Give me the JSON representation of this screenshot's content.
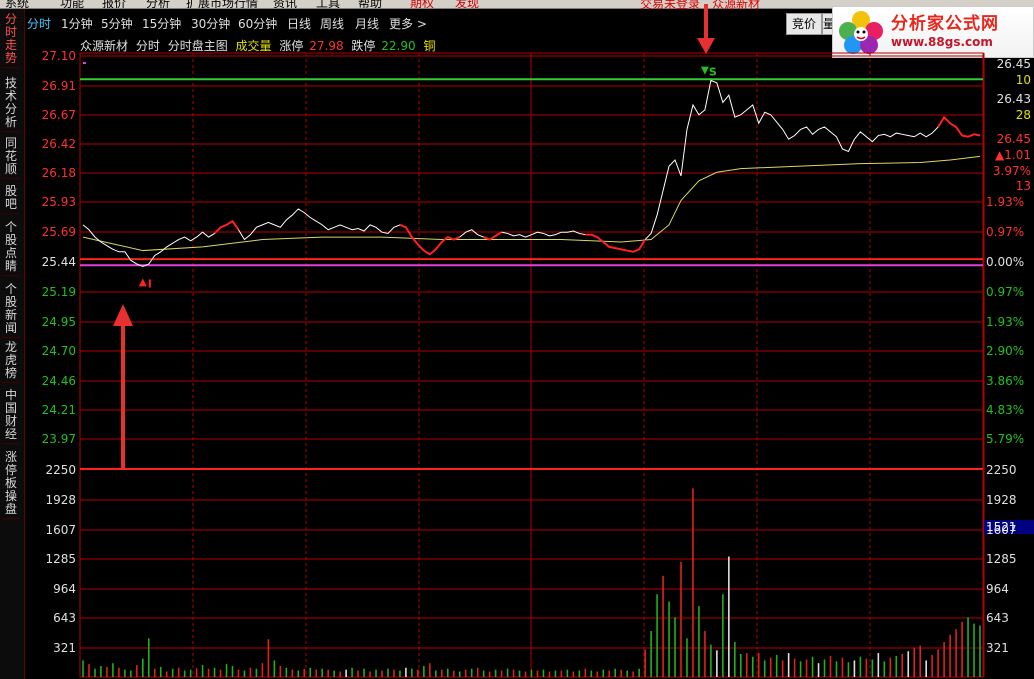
{
  "menu": {
    "items": [
      "系统",
      "功能",
      "报价",
      "分析",
      "扩展市场行情",
      "资讯",
      "工具",
      "帮助",
      "期权",
      "发现"
    ],
    "right_links": [
      "交易未登录",
      "众源新材"
    ]
  },
  "left_tabs": [
    {
      "label": "分时走势",
      "active": true
    },
    {
      "label": "技术分析",
      "active": false
    },
    {
      "label": "同花顺",
      "active": false
    },
    {
      "label": "股吧",
      "active": false
    },
    {
      "label": "个股点睛",
      "active": false
    },
    {
      "label": "个股新闻",
      "active": false
    },
    {
      "label": "龙虎榜",
      "active": false
    },
    {
      "label": "中国财经",
      "active": false
    },
    {
      "label": "涨停板操盘",
      "active": false
    }
  ],
  "period_tabs": [
    {
      "label": "分时",
      "active": true
    },
    {
      "label": "1分钟",
      "active": false
    },
    {
      "label": "5分钟",
      "active": false
    },
    {
      "label": "15分钟",
      "active": false
    },
    {
      "label": "30分钟",
      "active": false
    },
    {
      "label": "60分钟",
      "active": false
    },
    {
      "label": "日线",
      "active": false
    },
    {
      "label": "周线",
      "active": false
    },
    {
      "label": "月线",
      "active": false
    },
    {
      "label": "更多 >",
      "active": false
    }
  ],
  "auction_button": "竞价",
  "auction_button2": "量",
  "logo": {
    "title": "分析家公式网",
    "url_text": "www.88gs.com"
  },
  "info": {
    "stock_name": "众源新材",
    "chart_mode": "分时",
    "indicator": "分时盘主图",
    "volume_label": "成交量",
    "limit_up_label": "涨停",
    "limit_up_value": "27.98",
    "limit_down_label": "跌停",
    "limit_down_value": "22.90",
    "metal": "铜"
  },
  "colors": {
    "grid": "#b40000",
    "price_line_white": "#ffffff",
    "price_line_red": "#ff2020",
    "avg_line": "#d8d860",
    "up": "#ff3030",
    "down": "#20c020",
    "limit_green": "#33cc33",
    "limit_magenta": "#e040e0",
    "volume_up": "#e02020",
    "volume_down": "#20b020",
    "volume_white": "#e0e0e0"
  },
  "signals": {
    "buy_label": "I",
    "sell_label": "S"
  },
  "price_axis_left": [
    {
      "v": "27.10",
      "c": "up"
    },
    {
      "v": "26.91",
      "c": "up"
    },
    {
      "v": "26.67",
      "c": "up"
    },
    {
      "v": "26.42",
      "c": "up"
    },
    {
      "v": "26.18",
      "c": "up"
    },
    {
      "v": "25.93",
      "c": "up"
    },
    {
      "v": "25.69",
      "c": "up"
    },
    {
      "v": "25.44",
      "c": "flat"
    },
    {
      "v": "25.19",
      "c": "down"
    },
    {
      "v": "24.95",
      "c": "down"
    },
    {
      "v": "24.70",
      "c": "down"
    },
    {
      "v": "24.46",
      "c": "down"
    },
    {
      "v": "24.21",
      "c": "down"
    },
    {
      "v": "23.97",
      "c": "down"
    }
  ],
  "pct_axis_right": [
    {
      "v": "1.93%",
      "c": "up"
    },
    {
      "v": "0.97%",
      "c": "up"
    },
    {
      "v": "0.00%",
      "c": "flat"
    },
    {
      "v": "0.97%",
      "c": "down"
    },
    {
      "v": "1.93%",
      "c": "down"
    },
    {
      "v": "2.90%",
      "c": "down"
    },
    {
      "v": "3.86%",
      "c": "down"
    },
    {
      "v": "4.83%",
      "c": "down"
    },
    {
      "v": "5.79%",
      "c": "down"
    }
  ],
  "right_quote": [
    {
      "v": "26.45",
      "c": "flat"
    },
    {
      "v": "10",
      "c": "ylw"
    },
    {
      "v": "26.43",
      "c": "flat"
    },
    {
      "v": "28",
      "c": "ylw"
    },
    {
      "v": "26.45",
      "c": "up"
    },
    {
      "v": "▲1.01",
      "c": "up"
    },
    {
      "v": "3.97%",
      "c": "up"
    },
    {
      "v": "13",
      "c": "up"
    }
  ],
  "volume_axis": [
    "2250",
    "1928",
    "1607",
    "1285",
    "964",
    "643",
    "321"
  ],
  "volume_current": "1521",
  "chart_data": [
    {
      "type": "line",
      "title": "分时盘主图",
      "y_range": [
        23.97,
        27.1
      ],
      "prev_close": 25.44,
      "limit_up_line": 26.91,
      "limit_down_line": 25.39,
      "series": [
        {
          "points": [
            [
              0,
              25.72
            ],
            [
              1,
              25.68
            ],
            [
              2,
              25.62
            ],
            [
              3,
              25.58
            ],
            [
              4,
              25.55
            ],
            [
              5,
              25.52
            ],
            [
              6,
              25.5
            ],
            [
              7,
              25.5
            ],
            [
              8,
              25.43
            ],
            [
              9,
              25.4
            ],
            [
              10,
              25.38
            ],
            [
              11,
              25.4
            ],
            [
              12,
              25.47
            ],
            [
              13,
              25.5
            ],
            [
              14,
              25.54
            ],
            [
              15,
              25.57
            ],
            [
              16,
              25.6
            ],
            [
              17,
              25.62
            ],
            [
              18,
              25.59
            ],
            [
              19,
              25.62
            ],
            [
              20,
              25.66
            ],
            [
              21,
              25.62
            ],
            [
              22,
              25.65
            ],
            [
              23,
              25.7
            ],
            [
              24,
              25.72
            ],
            [
              25,
              25.75
            ],
            [
              26,
              25.68
            ],
            [
              27,
              25.6
            ],
            [
              28,
              25.64
            ],
            [
              29,
              25.7
            ],
            [
              30,
              25.72
            ],
            [
              31,
              25.74
            ],
            [
              32,
              25.72
            ],
            [
              33,
              25.7
            ],
            [
              34,
              25.76
            ],
            [
              35,
              25.8
            ],
            [
              36,
              25.85
            ],
            [
              37,
              25.82
            ],
            [
              38,
              25.78
            ],
            [
              39,
              25.75
            ],
            [
              40,
              25.72
            ],
            [
              41,
              25.68
            ],
            [
              42,
              25.7
            ],
            [
              43,
              25.72
            ],
            [
              44,
              25.7
            ],
            [
              45,
              25.68
            ],
            [
              46,
              25.69
            ],
            [
              47,
              25.67
            ],
            [
              48,
              25.72
            ],
            [
              49,
              25.7
            ],
            [
              50,
              25.66
            ],
            [
              51,
              25.65
            ],
            [
              52,
              25.7
            ],
            [
              53,
              25.72
            ],
            [
              54,
              25.7
            ],
            [
              55,
              25.62
            ],
            [
              56,
              25.56
            ],
            [
              57,
              25.51
            ],
            [
              58,
              25.48
            ],
            [
              59,
              25.52
            ],
            [
              60,
              25.58
            ],
            [
              61,
              25.62
            ],
            [
              62,
              25.6
            ],
            [
              63,
              25.62
            ],
            [
              64,
              25.66
            ],
            [
              65,
              25.68
            ],
            [
              66,
              25.64
            ],
            [
              67,
              25.62
            ],
            [
              68,
              25.6
            ],
            [
              69,
              25.63
            ],
            [
              70,
              25.66
            ],
            [
              71,
              25.65
            ],
            [
              72,
              25.63
            ],
            [
              73,
              25.64
            ],
            [
              74,
              25.62
            ],
            [
              75,
              25.64
            ],
            [
              76,
              25.66
            ],
            [
              77,
              25.65
            ],
            [
              78,
              25.63
            ],
            [
              79,
              25.64
            ],
            [
              80,
              25.66
            ],
            [
              81,
              25.66
            ],
            [
              82,
              25.67
            ],
            [
              83,
              25.65
            ],
            [
              84,
              25.64
            ],
            [
              85,
              25.64
            ],
            [
              86,
              25.62
            ],
            [
              87,
              25.58
            ],
            [
              88,
              25.54
            ],
            [
              89,
              25.53
            ],
            [
              90,
              25.52
            ],
            [
              91,
              25.51
            ],
            [
              92,
              25.5
            ],
            [
              93,
              25.52
            ],
            [
              94,
              25.6
            ],
            [
              95,
              25.65
            ],
            [
              96,
              25.8
            ],
            [
              97,
              26.0
            ],
            [
              98,
              26.2
            ],
            [
              99,
              26.25
            ],
            [
              100,
              26.12
            ],
            [
              101,
              26.5
            ],
            [
              102,
              26.7
            ],
            [
              103,
              26.62
            ],
            [
              104,
              26.66
            ],
            [
              105,
              26.9
            ],
            [
              106,
              26.88
            ],
            [
              107,
              26.72
            ],
            [
              108,
              26.78
            ],
            [
              109,
              26.6
            ],
            [
              110,
              26.62
            ],
            [
              111,
              26.66
            ],
            [
              112,
              26.7
            ],
            [
              113,
              26.55
            ],
            [
              114,
              26.64
            ],
            [
              115,
              26.62
            ],
            [
              116,
              26.56
            ],
            [
              117,
              26.5
            ],
            [
              118,
              26.42
            ],
            [
              119,
              26.45
            ],
            [
              120,
              26.5
            ],
            [
              121,
              26.52
            ],
            [
              122,
              26.46
            ],
            [
              123,
              26.5
            ],
            [
              124,
              26.52
            ],
            [
              125,
              26.48
            ],
            [
              126,
              26.44
            ],
            [
              127,
              26.34
            ],
            [
              128,
              26.32
            ],
            [
              129,
              26.42
            ],
            [
              130,
              26.48
            ],
            [
              131,
              26.44
            ],
            [
              132,
              26.4
            ],
            [
              133,
              26.45
            ],
            [
              134,
              26.46
            ],
            [
              135,
              26.44
            ],
            [
              136,
              26.47
            ],
            [
              137,
              26.46
            ],
            [
              138,
              26.45
            ],
            [
              139,
              26.44
            ],
            [
              140,
              26.47
            ],
            [
              141,
              26.44
            ],
            [
              142,
              26.47
            ],
            [
              143,
              26.52
            ],
            [
              144,
              26.6
            ],
            [
              145,
              26.55
            ],
            [
              146,
              26.52
            ],
            [
              147,
              26.45
            ],
            [
              148,
              26.44
            ],
            [
              149,
              26.46
            ],
            [
              150,
              26.45
            ]
          ]
        },
        {
          "points": [
            [
              0,
              25.62
            ],
            [
              10,
              25.51
            ],
            [
              20,
              25.54
            ],
            [
              30,
              25.6
            ],
            [
              40,
              25.62
            ],
            [
              50,
              25.62
            ],
            [
              60,
              25.6
            ],
            [
              70,
              25.6
            ],
            [
              80,
              25.6
            ],
            [
              90,
              25.58
            ],
            [
              95,
              25.6
            ],
            [
              98,
              25.72
            ],
            [
              100,
              25.92
            ],
            [
              103,
              26.08
            ],
            [
              106,
              26.15
            ],
            [
              110,
              26.18
            ],
            [
              120,
              26.2
            ],
            [
              130,
              26.22
            ],
            [
              140,
              26.23
            ],
            [
              145,
              26.25
            ],
            [
              150,
              26.28
            ]
          ]
        }
      ]
    },
    {
      "type": "bar",
      "title": "成交量",
      "y_range": [
        0,
        2250
      ],
      "values": [
        180,
        140,
        90,
        120,
        110,
        150,
        100,
        80,
        70,
        130,
        200,
        420,
        90,
        110,
        60,
        90,
        100,
        70,
        80,
        95,
        130,
        90,
        100,
        80,
        140,
        120,
        80,
        70,
        100,
        90,
        150,
        410,
        180,
        120,
        100,
        80,
        70,
        90,
        100,
        80,
        90,
        80,
        70,
        60,
        80,
        100,
        70,
        90,
        60,
        80,
        70,
        90,
        80,
        70,
        100,
        90,
        80,
        120,
        150,
        70,
        80,
        90,
        70,
        60,
        80,
        90,
        100,
        70,
        60,
        80,
        70,
        90,
        80,
        70,
        60,
        80,
        70,
        80,
        60,
        70,
        70,
        80,
        60,
        70,
        90,
        70,
        60,
        80,
        70,
        90,
        80,
        70,
        60,
        90,
        300,
        500,
        900,
        1100,
        820,
        650,
        1250,
        420,
        2050,
        770,
        500,
        350,
        290,
        900,
        1310,
        380,
        250,
        260,
        220,
        260,
        180,
        210,
        240,
        180,
        260,
        200,
        170,
        190,
        220,
        150,
        190,
        230,
        170,
        210,
        160,
        180,
        220,
        200,
        190,
        260,
        170,
        210,
        230,
        250,
        280,
        320,
        340,
        180,
        240,
        300,
        380,
        460,
        520,
        600,
        650,
        580,
        560
      ],
      "colors": [
        "d",
        "u",
        "d",
        "d",
        "u",
        "d",
        "u",
        "d",
        "d",
        "u",
        "d",
        "d",
        "u",
        "d",
        "u",
        "d",
        "u",
        "d",
        "d",
        "u",
        "d",
        "u",
        "d",
        "u",
        "d",
        "d",
        "u",
        "d",
        "u",
        "d",
        "u",
        "u",
        "d",
        "u",
        "d",
        "u",
        "d",
        "u",
        "d",
        "u",
        "d",
        "u",
        "d",
        "u",
        "w",
        "d",
        "u",
        "d",
        "u",
        "d",
        "u",
        "d",
        "u",
        "d",
        "w",
        "d",
        "u",
        "d",
        "u",
        "d",
        "u",
        "d",
        "u",
        "d",
        "u",
        "d",
        "u",
        "d",
        "u",
        "d",
        "u",
        "d",
        "u",
        "d",
        "u",
        "d",
        "u",
        "d",
        "u",
        "d",
        "u",
        "d",
        "u",
        "d",
        "u",
        "d",
        "u",
        "d",
        "u",
        "d",
        "u",
        "d",
        "u",
        "d",
        "u",
        "d",
        "d",
        "u",
        "d",
        "d",
        "u",
        "d",
        "u",
        "d",
        "u",
        "d",
        "w",
        "d",
        "w",
        "d",
        "d",
        "u",
        "d",
        "u",
        "d",
        "u",
        "d",
        "u",
        "w",
        "u",
        "d",
        "u",
        "d",
        "w",
        "d",
        "u",
        "d",
        "u",
        "d",
        "w",
        "d",
        "u",
        "d",
        "w",
        "d",
        "u",
        "d",
        "u",
        "w",
        "u",
        "u",
        "w",
        "u",
        "u",
        "u",
        "u",
        "u",
        "u",
        "d",
        "d",
        "d"
      ]
    }
  ]
}
